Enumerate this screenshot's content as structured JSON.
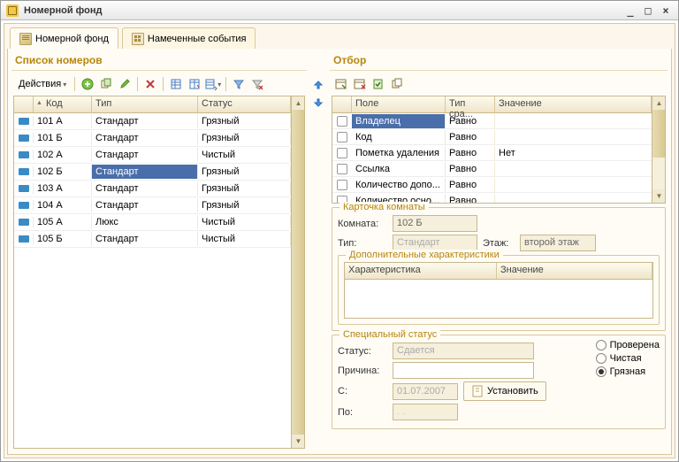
{
  "window": {
    "title": "Номерной фонд"
  },
  "tabs": [
    {
      "label": "Номерной фонд",
      "active": true
    },
    {
      "label": "Намеченные события",
      "active": false
    }
  ],
  "left": {
    "title": "Список номеров",
    "actions_label": "Действия",
    "columns": {
      "code": "Код",
      "type": "Тип",
      "status": "Статус"
    },
    "rows": [
      {
        "code": "101 А",
        "type": "Стандарт",
        "status": "Грязный"
      },
      {
        "code": "101 Б",
        "type": "Стандарт",
        "status": "Грязный"
      },
      {
        "code": "102 А",
        "type": "Стандарт",
        "status": "Чистый"
      },
      {
        "code": "102 Б",
        "type": "Стандарт",
        "status": "Грязный",
        "selected": true
      },
      {
        "code": "103 А",
        "type": "Стандарт",
        "status": "Грязный"
      },
      {
        "code": "104 А",
        "type": "Стандарт",
        "status": "Грязный"
      },
      {
        "code": "105 А",
        "type": "Люкс",
        "status": "Чистый"
      },
      {
        "code": "105 Б",
        "type": "Стандарт",
        "status": "Чистый"
      }
    ]
  },
  "right": {
    "title": "Отбор",
    "filter_columns": {
      "field": "Поле",
      "cmp": "Тип сра...",
      "value": "Значение"
    },
    "filters": [
      {
        "field": "Владелец",
        "cmp": "Равно",
        "value": "",
        "selected": true
      },
      {
        "field": "Код",
        "cmp": "Равно",
        "value": ""
      },
      {
        "field": "Пометка удаления",
        "cmp": "Равно",
        "value": "Нет"
      },
      {
        "field": "Ссылка",
        "cmp": "Равно",
        "value": ""
      },
      {
        "field": "Количество допо...",
        "cmp": "Равно",
        "value": ""
      },
      {
        "field": "Количество осно...",
        "cmp": "Равно",
        "value": ""
      }
    ],
    "card": {
      "title": "Карточка комнаты",
      "room_label": "Комната:",
      "room_value": "102 Б",
      "type_label": "Тип:",
      "type_value": "Стандарт",
      "floor_label": "Этаж:",
      "floor_value": "второй этаж",
      "extra_title": "Дополнительные характеристики",
      "extra_columns": {
        "char": "Характеристика",
        "value": "Значение"
      }
    },
    "special": {
      "title": "Специальный статус",
      "status_label": "Статус:",
      "status_value": "Сдается",
      "reason_label": "Причина:",
      "reason_value": "",
      "from_label": "С:",
      "from_value": "01.07.2007",
      "to_label": "По:",
      "to_value": "  .  .    ",
      "set_label": "Установить",
      "radios": [
        {
          "label": "Проверена",
          "checked": false
        },
        {
          "label": "Чистая",
          "checked": false
        },
        {
          "label": "Грязная",
          "checked": true
        }
      ]
    }
  }
}
